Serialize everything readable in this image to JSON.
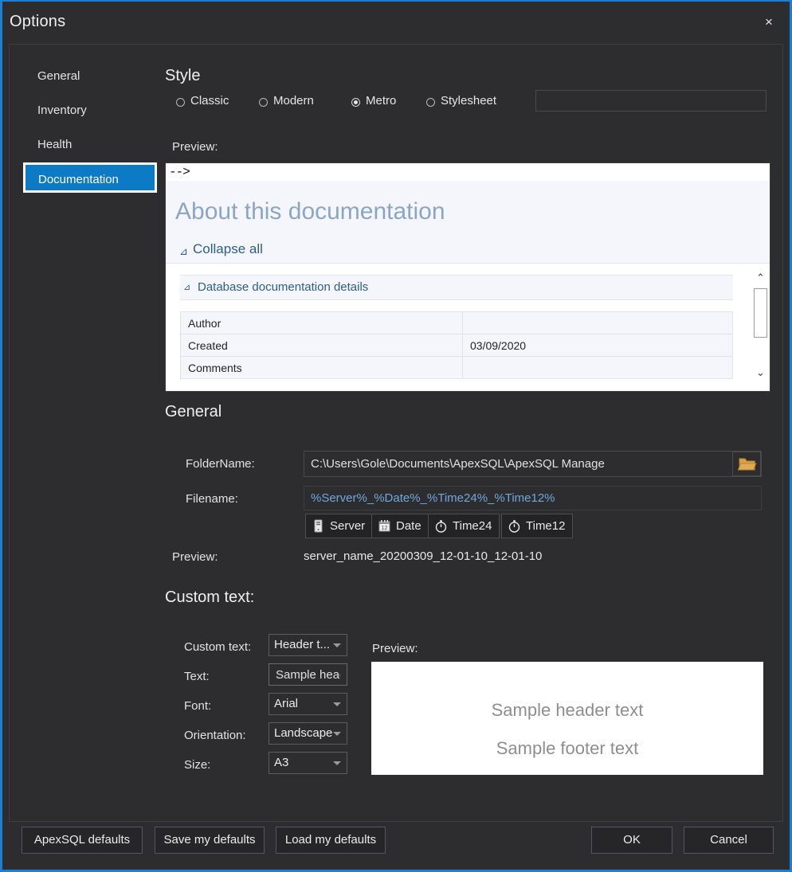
{
  "window": {
    "title": "Options",
    "close_label": "×",
    "accent": "#1b7fd4",
    "background": "#2d2d30"
  },
  "sidebar": {
    "items": [
      {
        "label": "General",
        "selected": false
      },
      {
        "label": "Inventory",
        "selected": false
      },
      {
        "label": "Health",
        "selected": false
      },
      {
        "label": "Documentation",
        "selected": true
      }
    ],
    "selected_color": "#0d7ac6"
  },
  "style_section": {
    "heading": "Style",
    "options": [
      {
        "label": "Classic",
        "selected": false
      },
      {
        "label": "Modern",
        "selected": false
      },
      {
        "label": "Metro",
        "selected": true
      },
      {
        "label": "Stylesheet",
        "selected": false
      }
    ],
    "stylesheet_path": "",
    "stylesheet_placeholder": "",
    "preview_label": "Preview:"
  },
  "doc_preview": {
    "arrow_text": "-->",
    "hero_title": "About this documentation",
    "collapse_all": "Collapse all",
    "collapse_triangle": "⊿",
    "section_title": "Database documentation details",
    "section_triangle": "⊿",
    "rows": [
      {
        "key": "Author",
        "value": ""
      },
      {
        "key": "Created",
        "value": "03/09/2020"
      },
      {
        "key": "Comments",
        "value": ""
      }
    ],
    "scroll_up": "⌃",
    "scroll_down": "⌄"
  },
  "general_section": {
    "heading": "General",
    "folder_label": "FolderName:",
    "folder_value": "C:\\Users\\Gole\\Documents\\ApexSQL\\ApexSQL Manage",
    "browse_icon": "folder-open-icon",
    "filename_label": "Filename:",
    "filename_value": "%Server%_%Date%_%Time24%_%Time12%",
    "tokens": [
      {
        "label": "Server",
        "icon": "server-icon"
      },
      {
        "label": "Date",
        "icon": "calendar-icon"
      },
      {
        "label": "Time24",
        "icon": "stopwatch-icon"
      },
      {
        "label": "Time12",
        "icon": "stopwatch-icon"
      }
    ],
    "preview_label": "Preview:",
    "preview_value": "server_name_20200309_12-01-10_12-01-10"
  },
  "custom_text_section": {
    "heading": "Custom text:",
    "fields": [
      {
        "label": "Custom text:",
        "value": "Header t...",
        "type": "dropdown"
      },
      {
        "label": "Text:",
        "value": "Sample heade",
        "type": "textbox"
      },
      {
        "label": "Font:",
        "value": "Arial",
        "type": "dropdown"
      },
      {
        "label": "Orientation:",
        "value": "Landscape",
        "type": "dropdown"
      },
      {
        "label": "Size:",
        "value": "A3",
        "type": "dropdown"
      }
    ],
    "preview_label": "Preview:",
    "preview_header_text": "Sample header text",
    "preview_footer_text": "Sample footer text"
  },
  "footer": {
    "left_buttons": [
      {
        "label": "ApexSQL defaults"
      },
      {
        "label": "Save my defaults"
      },
      {
        "label": "Load my defaults"
      }
    ],
    "right_buttons": [
      {
        "label": "OK"
      },
      {
        "label": "Cancel"
      }
    ]
  }
}
